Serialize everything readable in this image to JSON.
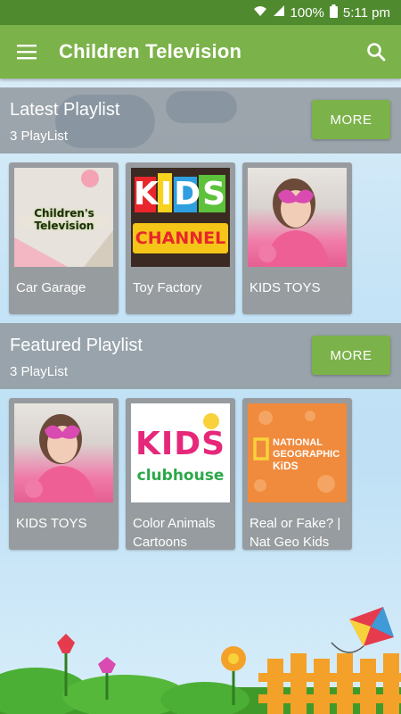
{
  "status": {
    "wifi": "wifi-icon",
    "signal": "signal-icon",
    "battery_percent": "100%",
    "time": "5:11 pm"
  },
  "app_bar": {
    "title": "Children Television",
    "menu_icon": "hamburger-menu-icon",
    "search_icon": "search-icon"
  },
  "sections": [
    {
      "title": "Latest Playlist",
      "subtitle": "3 PlayList",
      "more_label": "MORE",
      "items": [
        {
          "label": "Car Garage",
          "thumb_text": [
            "Children's",
            "Television"
          ]
        },
        {
          "label": "Toy Factory",
          "thumb_text": [
            "KIDS",
            "CHANNEL"
          ]
        },
        {
          "label": "KIDS TOYS"
        }
      ]
    },
    {
      "title": "Featured Playlist",
      "subtitle": "3 PlayList",
      "more_label": "MORE",
      "items": [
        {
          "label": "KIDS TOYS"
        },
        {
          "label": "Color Animals Cartoons",
          "thumb_text": [
            "KIDS",
            "clubhouse"
          ]
        },
        {
          "label": "Real or Fake? | Nat Geo Kids",
          "thumb_text": [
            "NATIONAL",
            "GEOGRAPHIC",
            "KiDS"
          ]
        }
      ]
    }
  ],
  "colors": {
    "status_bar": "#4f8a2e",
    "app_bar": "#7cb24a",
    "accent": "#7cb24a"
  }
}
